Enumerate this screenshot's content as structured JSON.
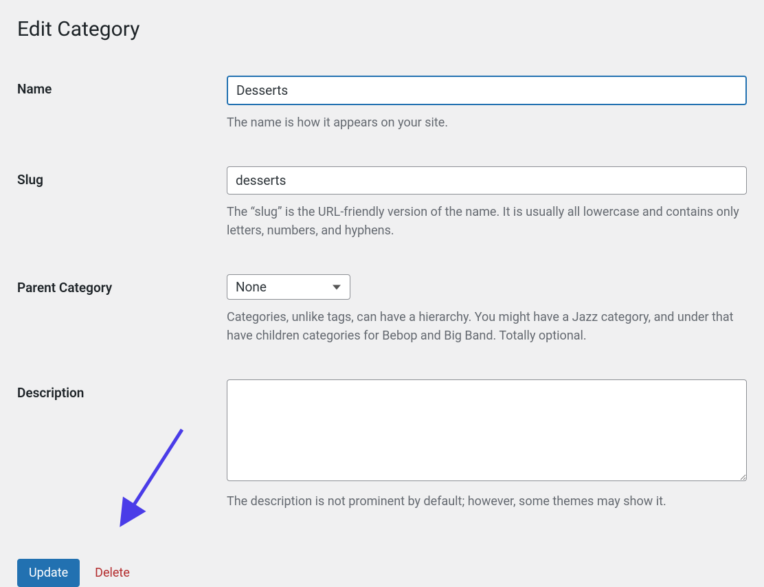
{
  "page": {
    "title": "Edit Category"
  },
  "fields": {
    "name": {
      "label": "Name",
      "value": "Desserts",
      "help": "The name is how it appears on your site."
    },
    "slug": {
      "label": "Slug",
      "value": "desserts",
      "help": "The “slug” is the URL-friendly version of the name. It is usually all lowercase and contains only letters, numbers, and hyphens."
    },
    "parent": {
      "label": "Parent Category",
      "value": "None",
      "help": "Categories, unlike tags, can have a hierarchy. You might have a Jazz category, and under that have children categories for Bebop and Big Band. Totally optional."
    },
    "description": {
      "label": "Description",
      "value": "",
      "help": "The description is not prominent by default; however, some themes may show it."
    }
  },
  "actions": {
    "update": "Update",
    "delete": "Delete"
  }
}
